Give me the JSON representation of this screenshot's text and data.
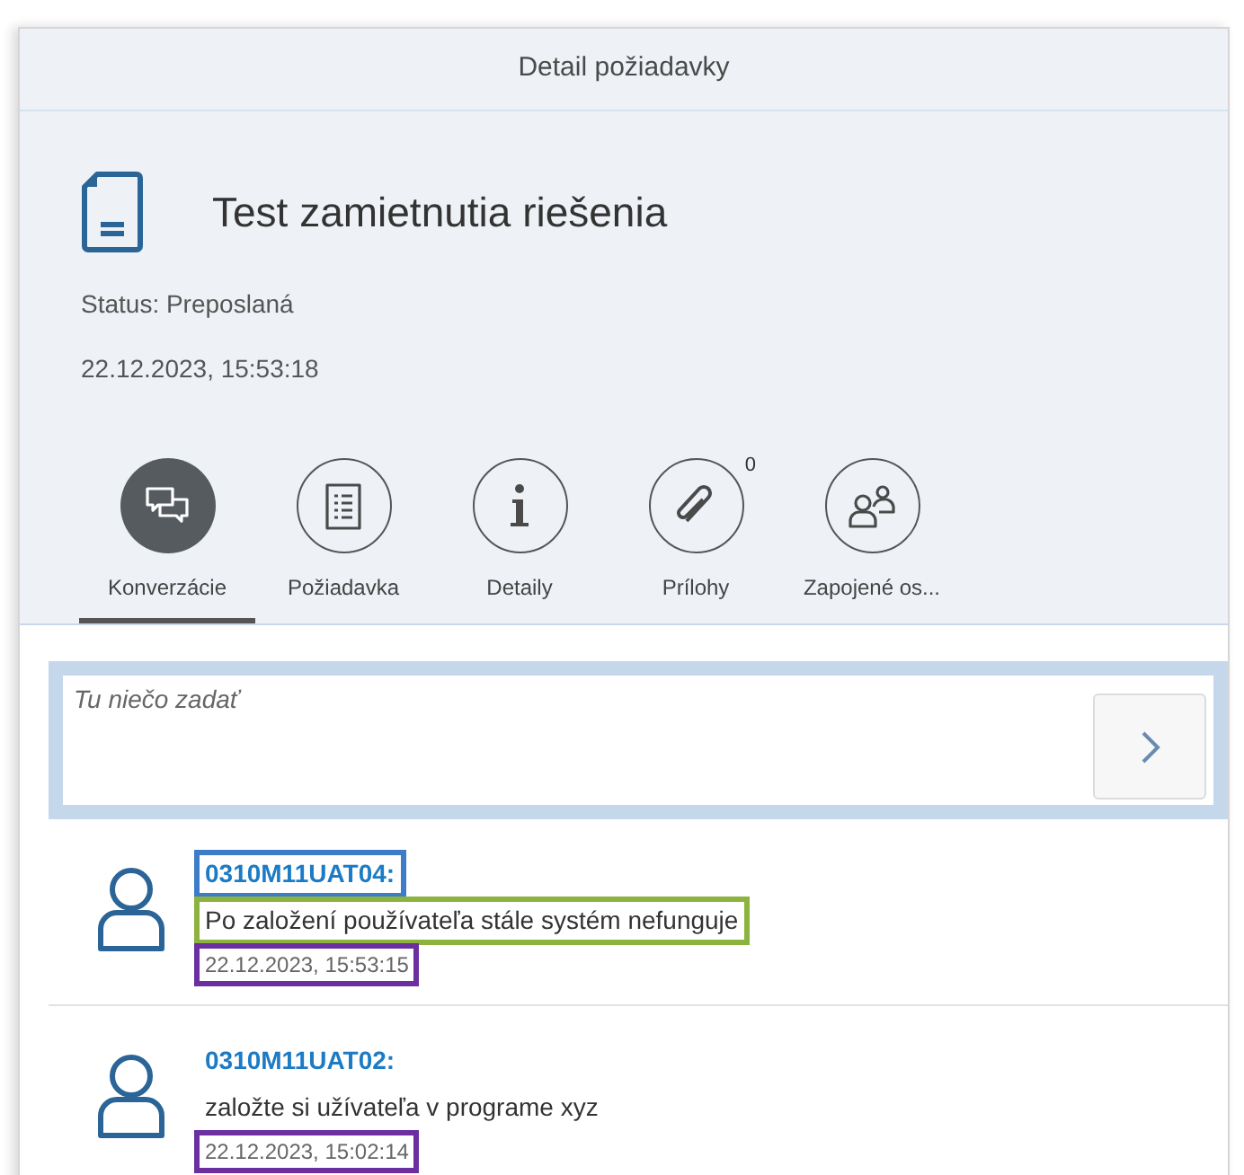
{
  "window": {
    "title": "Detail požiadavky"
  },
  "header": {
    "title": "Test zamietnutia riešenia",
    "status": "Status: Preposlaná",
    "date": "22.12.2023, 15:53:18"
  },
  "tabs": [
    {
      "kind": "chat",
      "label": "Konverzácie",
      "selected": true
    },
    {
      "kind": "list",
      "label": "Požiadavka",
      "selected": false
    },
    {
      "kind": "info",
      "label": "Detaily",
      "selected": false
    },
    {
      "kind": "attach",
      "label": "Prílohy",
      "selected": false,
      "count": "0"
    },
    {
      "kind": "people",
      "label": "Zapojené os...",
      "selected": false
    }
  ],
  "input": {
    "placeholder": "Tu niečo zadať"
  },
  "messages": [
    {
      "author": {
        "text": "0310M11UAT04:",
        "color": "#3d7cc9"
      },
      "text": {
        "text": "Po založení používateľa stále systém nefunguje",
        "color": "#8db33f"
      },
      "time": {
        "text": "22.12.2023, 15:53:15",
        "color": "#6b2fa0"
      }
    },
    {
      "author": {
        "text": "0310M11UAT02:"
      },
      "text": {
        "text": "založte si užívateľa v programe xyz"
      },
      "time": {
        "text": "22.12.2023, 15:02:14",
        "color": "#6b2fa0"
      }
    }
  ]
}
